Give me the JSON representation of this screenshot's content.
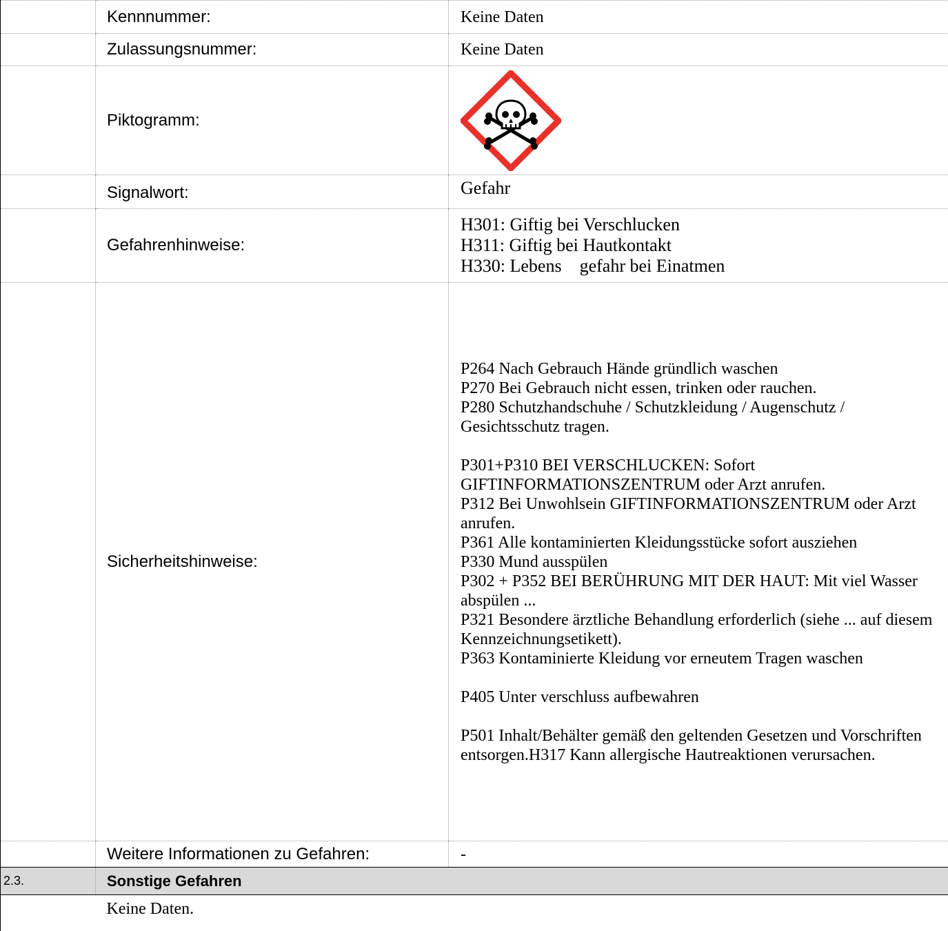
{
  "rows": {
    "kennnummer": {
      "label": "Kennnummer:",
      "value": "Keine Daten"
    },
    "zulassungsnummer": {
      "label": "Zulassungsnummer:",
      "value": "Keine Daten"
    },
    "piktogramm": {
      "label": "Piktogramm:",
      "icon": "ghs06-skull-crossbones-icon"
    },
    "signalwort": {
      "label": "Signalwort:",
      "value": "Gefahr"
    },
    "gefahrenhinweise": {
      "label": "Gefahrenhinweise:",
      "statements": [
        "H301: Giftig bei Verschlucken",
        "H311: Giftig bei Hautkontakt",
        "H330: Lebens    gefahr bei Einatmen"
      ]
    },
    "sicherheitshinweise": {
      "label": "Sicherheitshinweise:",
      "statements": [
        "P264 Nach Gebrauch Hände gründlich waschen",
        "P270 Bei Gebrauch nicht essen, trinken oder rauchen.",
        "P280 Schutzhandschuhe / Schutzkleidung / Augenschutz / Gesichtsschutz tragen.",
        "",
        "P301+P310 BEI VERSCHLUCKEN: Sofort GIFTINFORMATIONSZENTRUM oder Arzt anrufen.",
        "P312 Bei Unwohlsein GIFTINFORMATIONSZENTRUM oder Arzt anrufen.",
        "P361 Alle kontaminierten Kleidungsstücke sofort ausziehen",
        "P330 Mund ausspülen",
        "P302 + P352 BEI BERÜHRUNG MIT DER HAUT: Mit viel Wasser abspülen ...",
        "P321 Besondere ärztliche Behandlung erforderlich (siehe ... auf diesem Kennzeichnungsetikett).",
        "P363 Kontaminierte Kleidung vor erneutem Tragen waschen",
        "",
        "P405 Unter verschluss aufbewahren",
        "",
        "P501 Inhalt/Behälter gemäß den geltenden Gesetzen und Vorschriften entsorgen.H317 Kann allergische Hautreaktionen verursachen."
      ]
    },
    "weitere": {
      "label": "Weitere Informationen zu Gefahren:",
      "value": "-"
    }
  },
  "section": {
    "number": "2.3.",
    "title": "Sonstige Gefahren",
    "body": "Keine Daten."
  },
  "colors": {
    "pictogram_border": "#e8312b",
    "section_bg": "#d9d9d9"
  }
}
